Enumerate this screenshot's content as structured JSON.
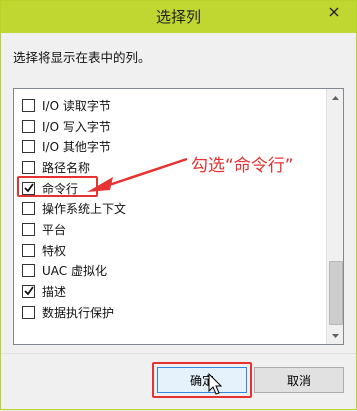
{
  "window": {
    "title": "选择列"
  },
  "description": "选择将显示在表中的列。",
  "columns": [
    {
      "label": "I/O 读取字节",
      "checked": false
    },
    {
      "label": "I/O 写入字节",
      "checked": false
    },
    {
      "label": "I/O 其他字节",
      "checked": false
    },
    {
      "label": "路径名称",
      "checked": false
    },
    {
      "label": "命令行",
      "checked": true
    },
    {
      "label": "操作系统上下文",
      "checked": false
    },
    {
      "label": "平台",
      "checked": false
    },
    {
      "label": "特权",
      "checked": false
    },
    {
      "label": "UAC 虚拟化",
      "checked": false
    },
    {
      "label": "描述",
      "checked": true
    },
    {
      "label": "数据执行保护",
      "checked": false
    }
  ],
  "annotation": "勾选“命令行”",
  "buttons": {
    "ok": "确定",
    "cancel": "取消"
  },
  "colors": {
    "titlebar": "#bfd730",
    "annotation": "#e53333",
    "list_background": "#ffffff"
  },
  "icons": {
    "close": "close-icon",
    "check": "checkmark-icon",
    "cursor": "mouse-pointer-icon"
  }
}
